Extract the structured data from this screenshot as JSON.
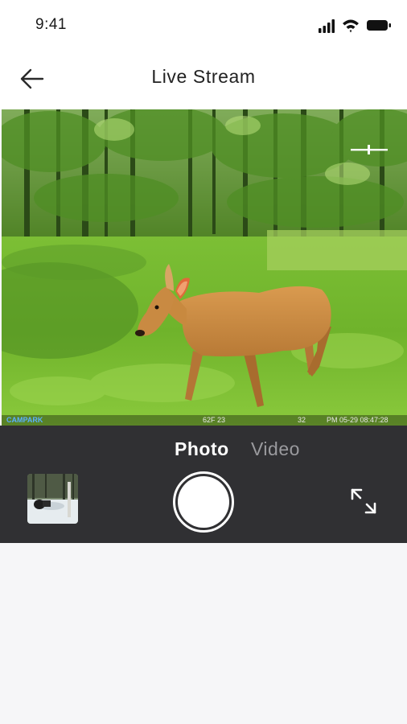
{
  "status_bar": {
    "time": "9:41"
  },
  "header": {
    "title": "Live Stream",
    "back_icon": "arrow-left-icon"
  },
  "stream": {
    "watermark": "CAMPARK",
    "overlay_temp": "62F 23",
    "overlay_moon": "32",
    "overlay_datetime": "PM 05-29 08:47:28"
  },
  "controls": {
    "mode_photo": "Photo",
    "mode_video": "Video",
    "active_mode": "Photo",
    "shutter_icon": "shutter-icon",
    "fullscreen_icon": "expand-icon"
  },
  "colors": {
    "panel_bg": "#303033",
    "active_tab": "#ffffff",
    "inactive_tab": "#9a9a9e"
  }
}
